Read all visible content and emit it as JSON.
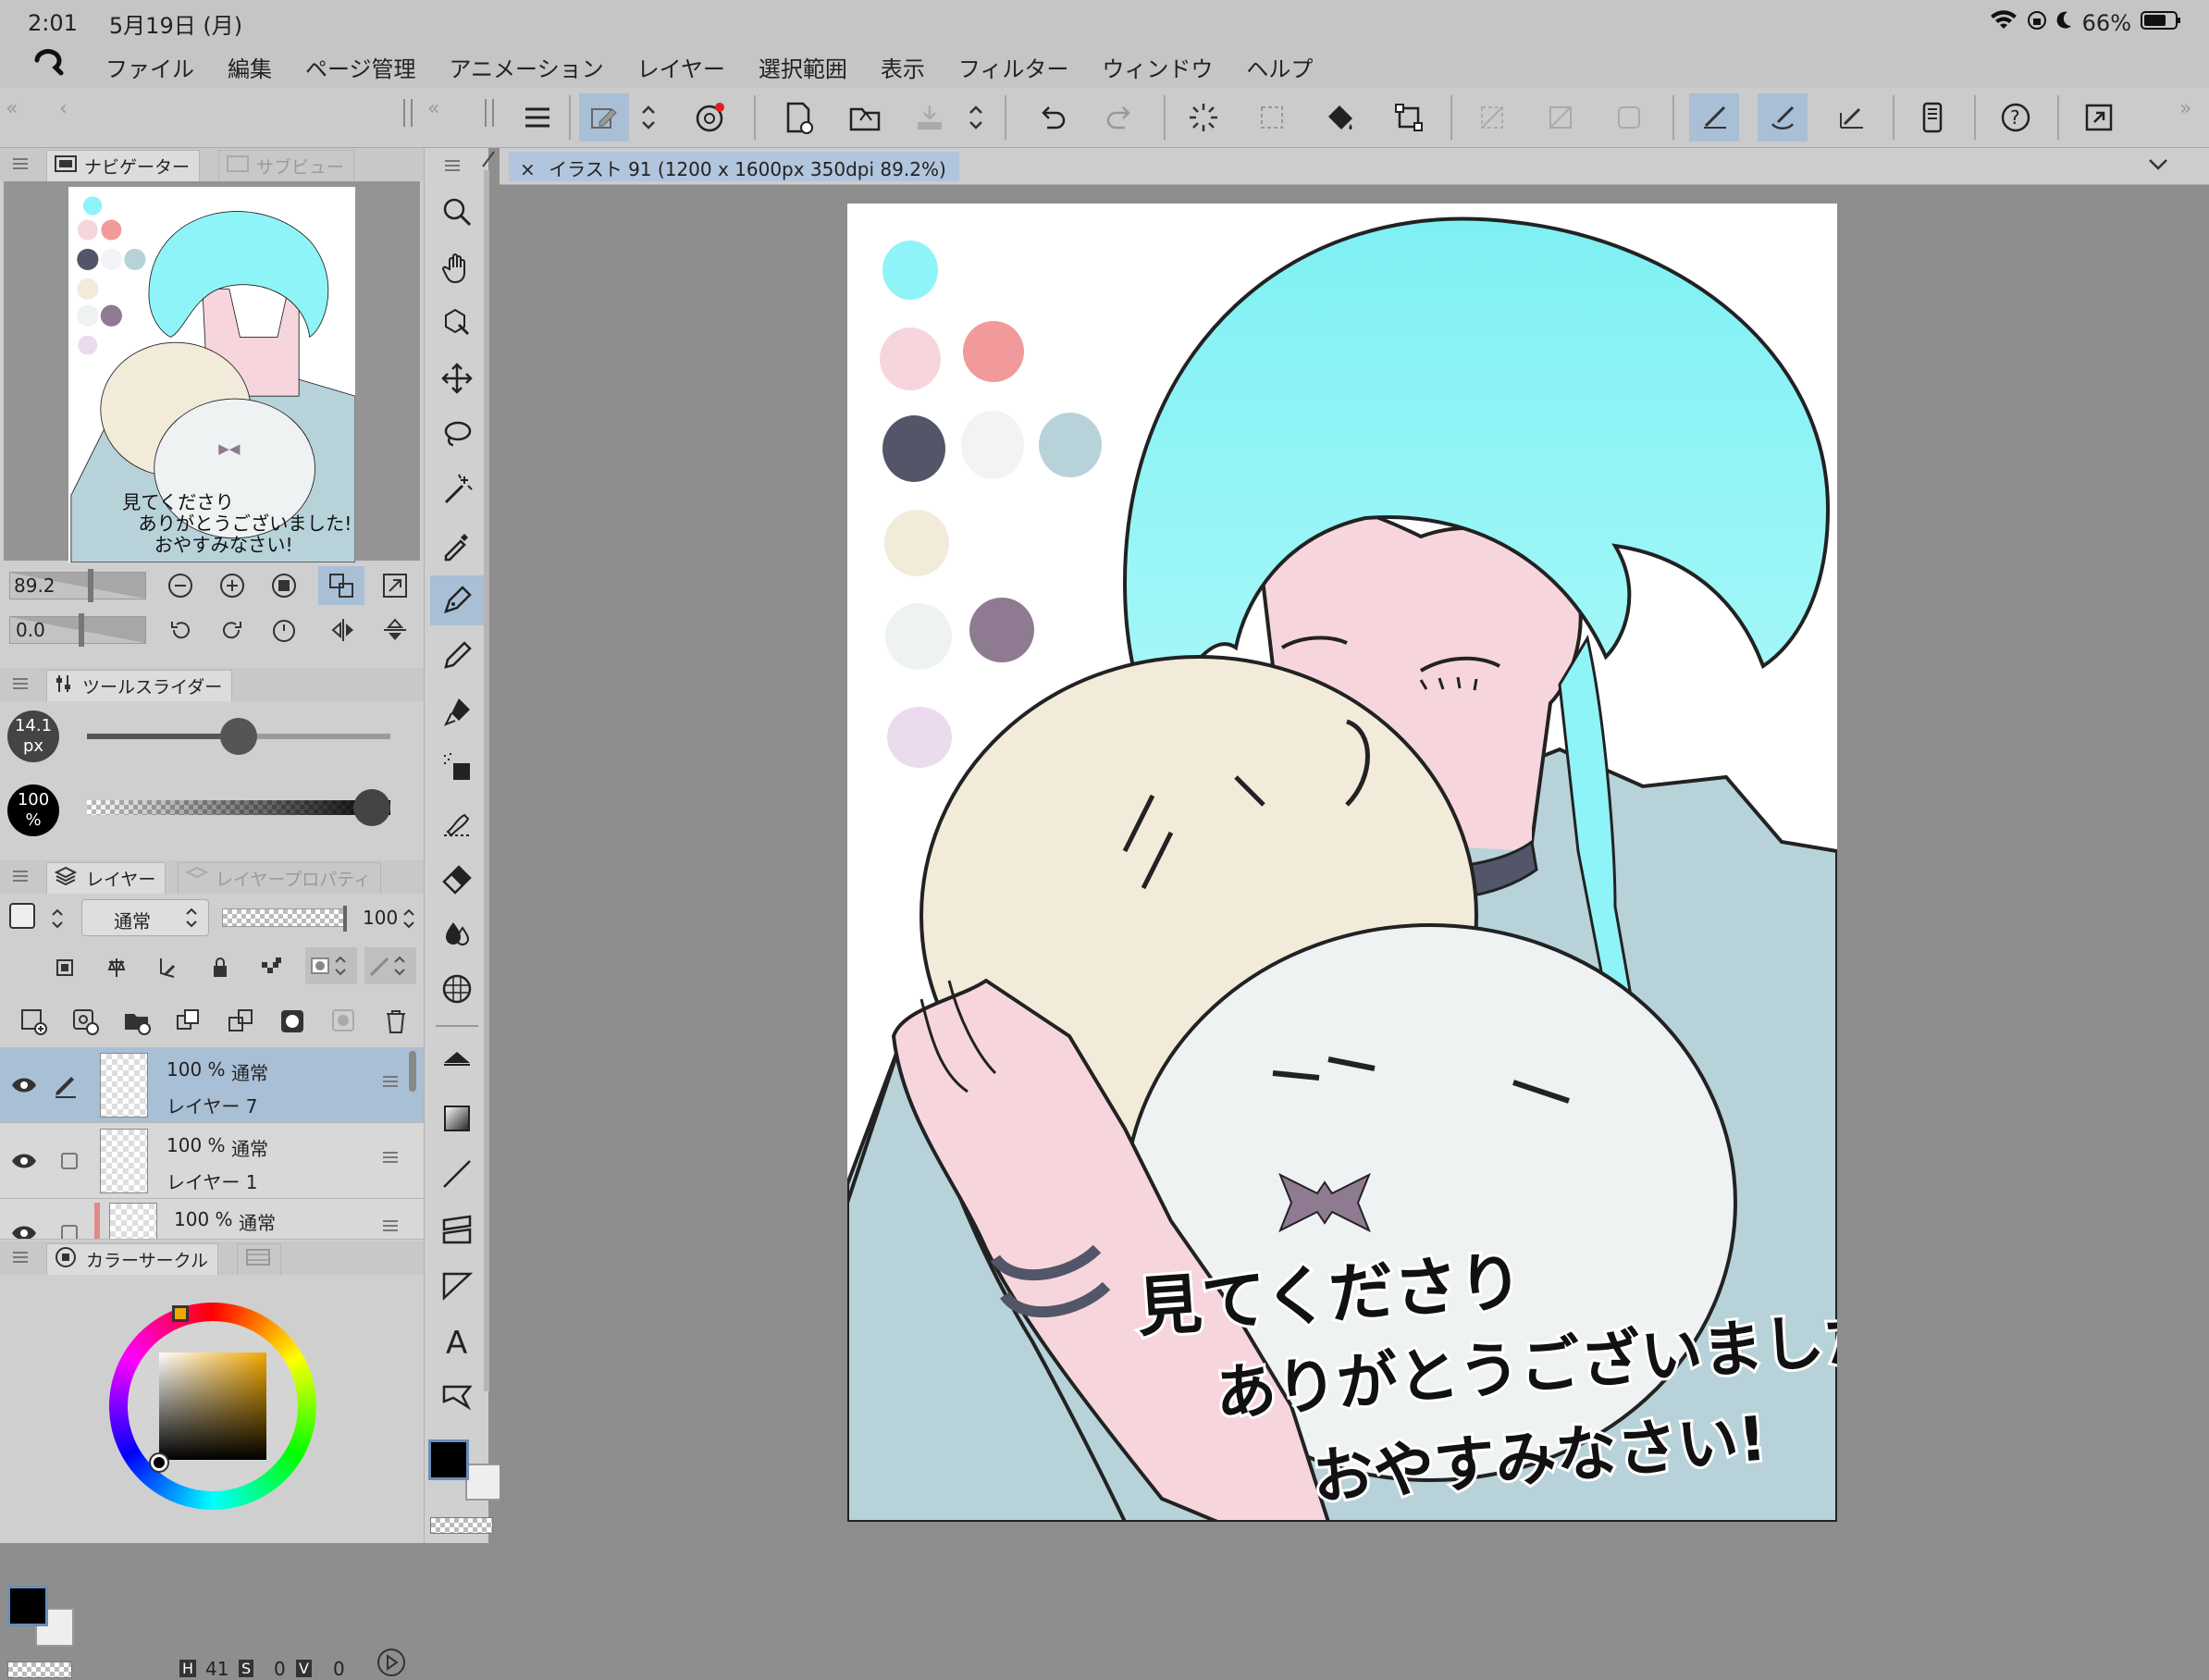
{
  "status": {
    "time": "2:01",
    "date": "5月19日 (月)",
    "battery": "66%"
  },
  "menu": {
    "items": [
      "ファイル",
      "編集",
      "ページ管理",
      "アニメーション",
      "レイヤー",
      "選択範囲",
      "表示",
      "フィルター",
      "ウィンドウ",
      "ヘルプ"
    ]
  },
  "document": {
    "tab_title": "イラスト 91 (1200 x 1600px 350dpi 89.2%)",
    "close_glyph": "×"
  },
  "navigator": {
    "tab_label": "ナビゲーター",
    "subview_label": "サブビュー",
    "zoom_value": "89.2",
    "rotation_value": "0.0"
  },
  "tool_slider": {
    "title": "ツールスライダー",
    "size_value": "14.1",
    "size_unit": "px",
    "opacity_value": "100",
    "opacity_unit": "%",
    "size_fraction": 0.5,
    "opacity_fraction": 1.0
  },
  "layers": {
    "tab_label": "レイヤー",
    "property_tab_label": "レイヤープロパティ",
    "blend_mode": "通常",
    "opacity": "100",
    "rows": [
      {
        "percent": "100 %",
        "mode": "通常",
        "name": "レイヤー 7",
        "selected": true
      },
      {
        "percent": "100 %",
        "mode": "通常",
        "name": "レイヤー 1",
        "selected": false
      },
      {
        "percent": "100 %",
        "mode": "通常",
        "name": "",
        "selected": false
      }
    ]
  },
  "color_circle": {
    "title": "カラーサークル",
    "h_label": "H",
    "h_value": "41",
    "s_label": "S",
    "s_value": "0",
    "v_label": "V",
    "v_value": "0"
  },
  "artwork": {
    "message_line1": "見てくださり",
    "message_line2": "ありがとうございました!",
    "message_line3": "おやすみなさい!",
    "palette": [
      "#8ff4f7",
      "#f6d6dc",
      "#f29a9b",
      "#525668",
      "#f1f3f5",
      "#b8d2da",
      "#f3ebda",
      "#eef2f2",
      "#8e7a91",
      "#ecdaee"
    ]
  },
  "colors": {
    "selection": "#a9bfd6",
    "main_color": "#000000"
  }
}
